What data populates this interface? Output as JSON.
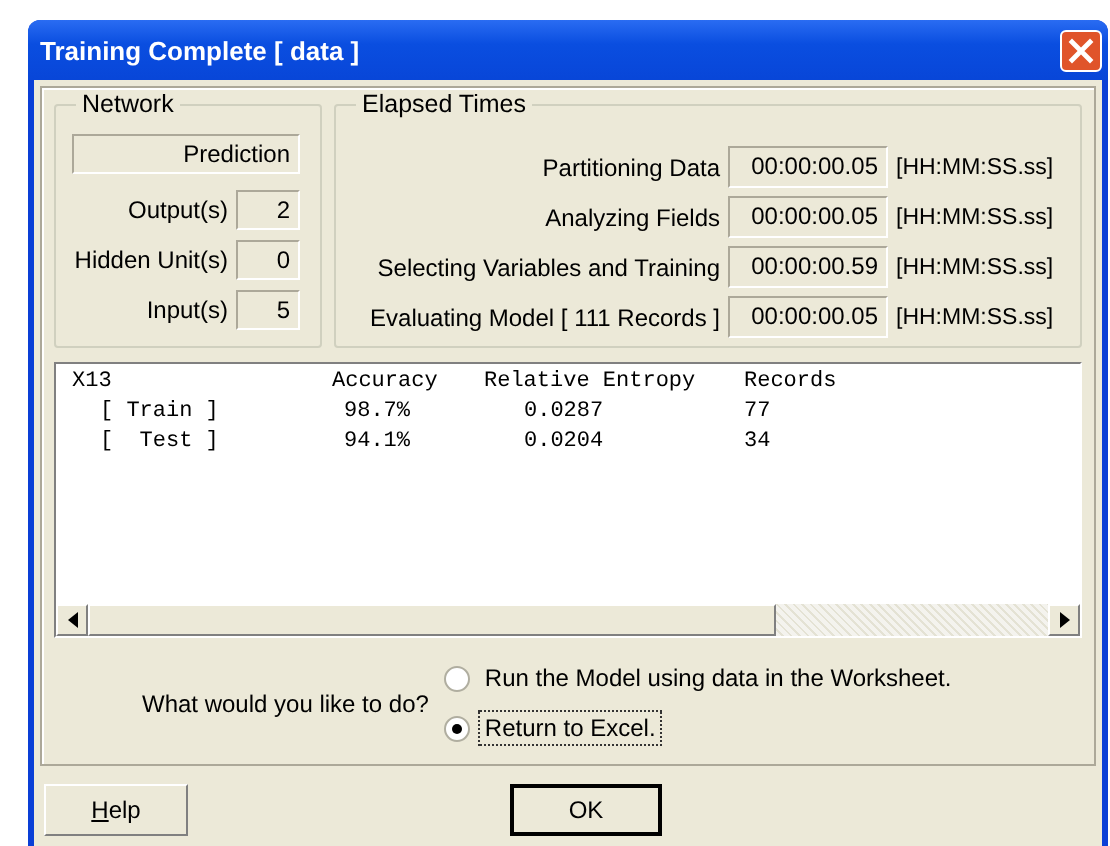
{
  "window": {
    "title": "Training Complete [ data ]"
  },
  "network": {
    "title": "Network",
    "type": "Prediction",
    "fields": [
      {
        "label": "Output(s)",
        "value": "2"
      },
      {
        "label": "Hidden Unit(s)",
        "value": "0"
      },
      {
        "label": "Input(s)",
        "value": "5"
      }
    ]
  },
  "elapsed_times": {
    "title": "Elapsed Times",
    "rows": [
      {
        "label": "Partitioning Data",
        "value": "00:00:00.05",
        "unit": "[HH:MM:SS.ss]"
      },
      {
        "label": "Analyzing Fields",
        "value": "00:00:00.05",
        "unit": "[HH:MM:SS.ss]"
      },
      {
        "label": "Selecting Variables and Training",
        "value": "00:00:00.59",
        "unit": "[HH:MM:SS.ss]"
      },
      {
        "label": "Evaluating Model [ 111 Records ]",
        "value": "00:00:00.05",
        "unit": "[HH:MM:SS.ss]"
      }
    ]
  },
  "results": {
    "columns": [
      "X13",
      "Accuracy",
      "Relative Entropy",
      "Records"
    ],
    "rows": [
      {
        "cells": [
          "[ Train ]",
          "98.7%",
          "0.0287",
          "77"
        ]
      },
      {
        "cells": [
          "[  Test ]",
          "94.1%",
          "0.0204",
          "34"
        ]
      }
    ]
  },
  "question": {
    "label": "What would you like to do?",
    "options": [
      {
        "label": "Run the Model using data in the Worksheet.",
        "selected": false
      },
      {
        "label": "Return to Excel.",
        "selected": true
      }
    ]
  },
  "buttons": [
    {
      "label": "Help",
      "default": false
    },
    {
      "label": "OK",
      "default": true
    }
  ]
}
